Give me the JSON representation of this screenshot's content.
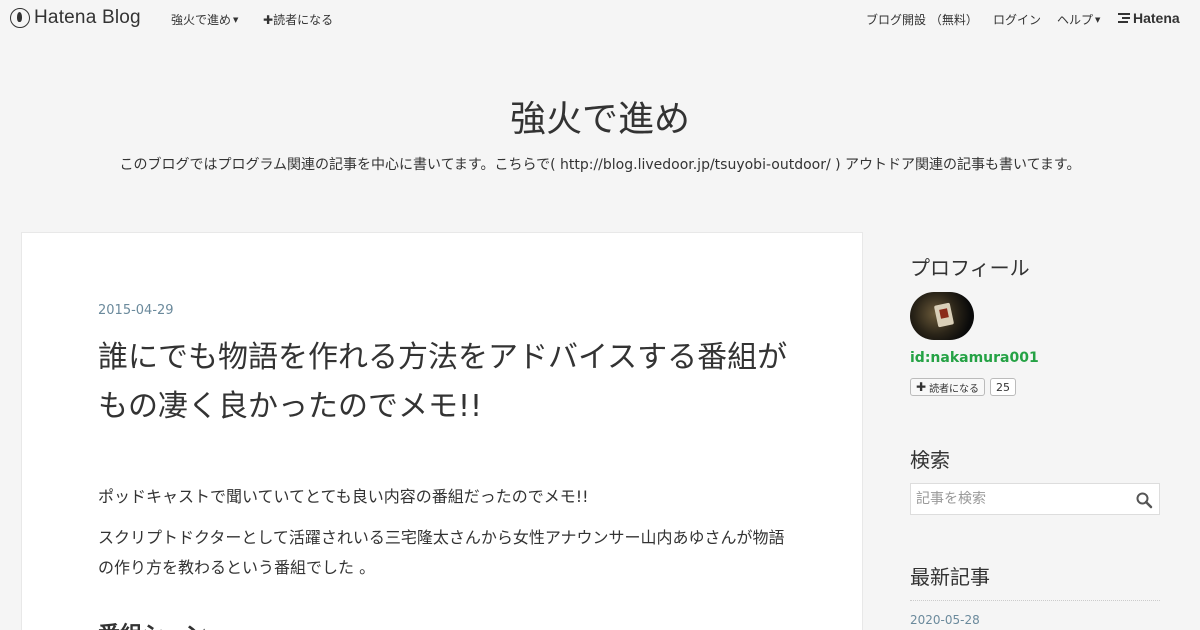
{
  "global_header": {
    "logo_text": "Hatena Blog",
    "menu_blog": "強火で進め",
    "subscribe_label": "読者になる",
    "open_blog": "ブログ開設 （無料）",
    "login": "ログイン",
    "help": "ヘルプ",
    "hatena_brand": "Hatena"
  },
  "blog": {
    "title": "強火で進め",
    "description": "このブログではプログラム関連の記事を中心に書いてます。こちらで( http://blog.livedoor.jp/tsuyobi-outdoor/ ) アウトドア関連の記事も書いてます。"
  },
  "entry": {
    "date": "2015-04-29",
    "title": "誰にでも物語を作れる方法をアドバイスする番組がもの凄く良かったのでメモ!!",
    "paragraph1": "ポッドキャストで聞いていてとても良い内容の番組だったのでメモ!!",
    "paragraph2": "スクリプトドクターとして活躍されいる三宅隆太さんから女性アナウンサー山内あゆさんが物語の作り方を教わるという番組でした 。",
    "heading": "番組シーン"
  },
  "sidebar": {
    "profile_title": "プロフィール",
    "profile_id": "id:nakamura001",
    "subscribe_label": "読者になる",
    "subscriber_count": "25",
    "search_title": "検索",
    "search_placeholder": "記事を検索",
    "recent_title": "最新記事",
    "recent_first_date": "2020-05-28"
  },
  "colors": {
    "background": "#f5f5f5",
    "date": "#6b8a9c",
    "profile_id": "#25a245"
  },
  "icons": {
    "logo": "hatena-blog-logo-icon",
    "search": "search-icon",
    "plus": "plus-icon",
    "caret": "caret-down-icon"
  }
}
